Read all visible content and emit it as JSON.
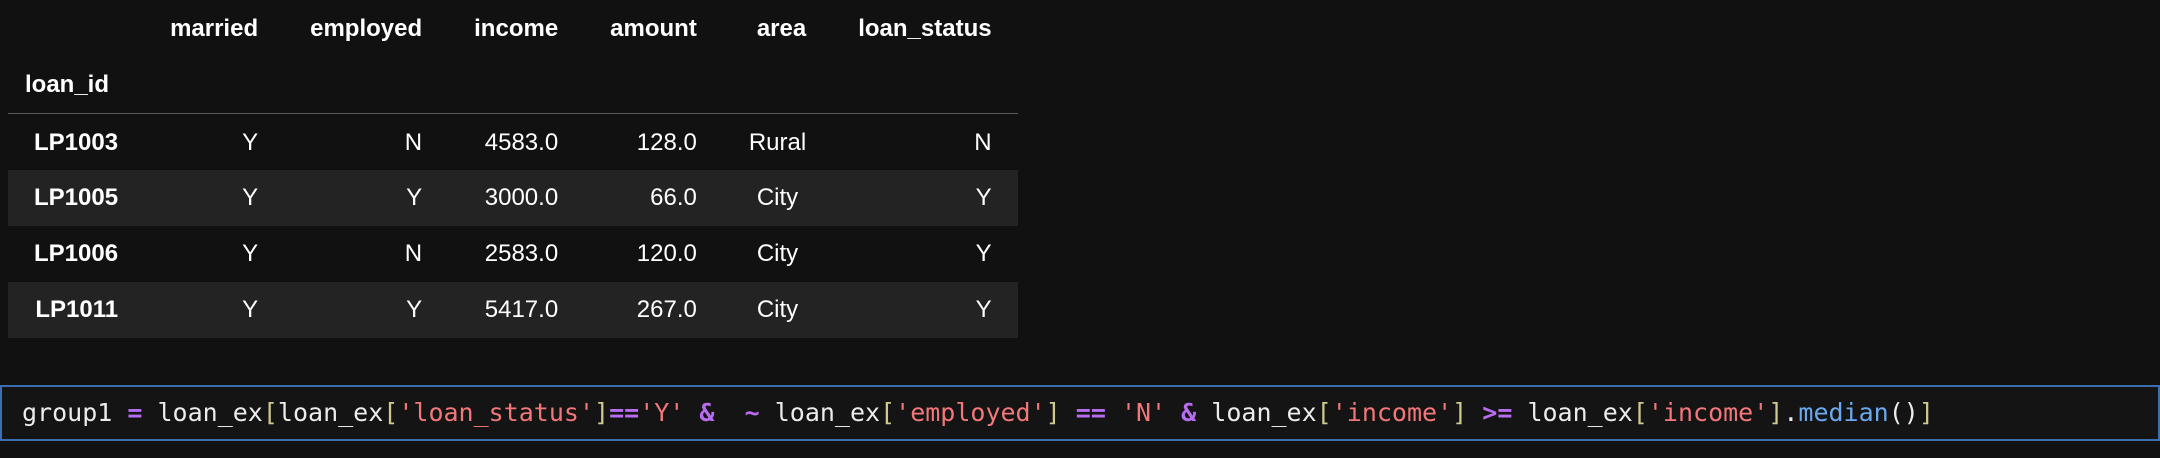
{
  "table": {
    "columns": [
      "married",
      "employed",
      "income",
      "amount",
      "area",
      "loan_status"
    ],
    "index_name": "loan_id",
    "rows": [
      {
        "id": "LP1003",
        "married": "Y",
        "employed": "N",
        "income": "4583.0",
        "amount": "128.0",
        "area": "Rural",
        "loan_status": "N"
      },
      {
        "id": "LP1005",
        "married": "Y",
        "employed": "Y",
        "income": "3000.0",
        "amount": "66.0",
        "area": "City",
        "loan_status": "Y"
      },
      {
        "id": "LP1006",
        "married": "Y",
        "employed": "N",
        "income": "2583.0",
        "amount": "120.0",
        "area": "City",
        "loan_status": "Y"
      },
      {
        "id": "LP1011",
        "married": "Y",
        "employed": "Y",
        "income": "5417.0",
        "amount": "267.0",
        "area": "City",
        "loan_status": "Y"
      }
    ]
  },
  "code": {
    "tokens": [
      [
        "group1",
        "var"
      ],
      [
        " ",
        "sp"
      ],
      [
        "=",
        "op"
      ],
      [
        " ",
        "sp"
      ],
      [
        "loan_ex",
        "var"
      ],
      [
        "[",
        "br"
      ],
      [
        "loan_ex",
        "var"
      ],
      [
        "[",
        "br"
      ],
      [
        "'loan_status'",
        "str"
      ],
      [
        "]",
        "br"
      ],
      [
        "==",
        "op"
      ],
      [
        "'Y'",
        "str"
      ],
      [
        " ",
        "sp"
      ],
      [
        "&",
        "op"
      ],
      [
        " ",
        "sp"
      ],
      [
        " ",
        "sp"
      ],
      [
        "~",
        "op"
      ],
      [
        " ",
        "sp"
      ],
      [
        "loan_ex",
        "var"
      ],
      [
        "[",
        "br"
      ],
      [
        "'employed'",
        "str"
      ],
      [
        "]",
        "br"
      ],
      [
        " ",
        "sp"
      ],
      [
        "==",
        "op"
      ],
      [
        " ",
        "sp"
      ],
      [
        "'N'",
        "str"
      ],
      [
        " ",
        "sp"
      ],
      [
        "&",
        "op"
      ],
      [
        " ",
        "sp"
      ],
      [
        "loan_ex",
        "var"
      ],
      [
        "[",
        "br"
      ],
      [
        "'income'",
        "str"
      ],
      [
        "]",
        "br"
      ],
      [
        " ",
        "sp"
      ],
      [
        ">=",
        "op"
      ],
      [
        " ",
        "sp"
      ],
      [
        "loan_ex",
        "var"
      ],
      [
        "[",
        "br"
      ],
      [
        "'income'",
        "str"
      ],
      [
        "]",
        "br"
      ],
      [
        ".",
        "var"
      ],
      [
        "median",
        "fn"
      ],
      [
        "()",
        "var"
      ],
      [
        "]",
        "br"
      ]
    ]
  },
  "colors": {
    "background": "#111111",
    "row_stripe": "#232323",
    "editor_border": "#3a6fb0",
    "operator": "#b86cf0",
    "string": "#f2777a",
    "bracket": "#cfc98f",
    "function": "#6aa9f0"
  }
}
